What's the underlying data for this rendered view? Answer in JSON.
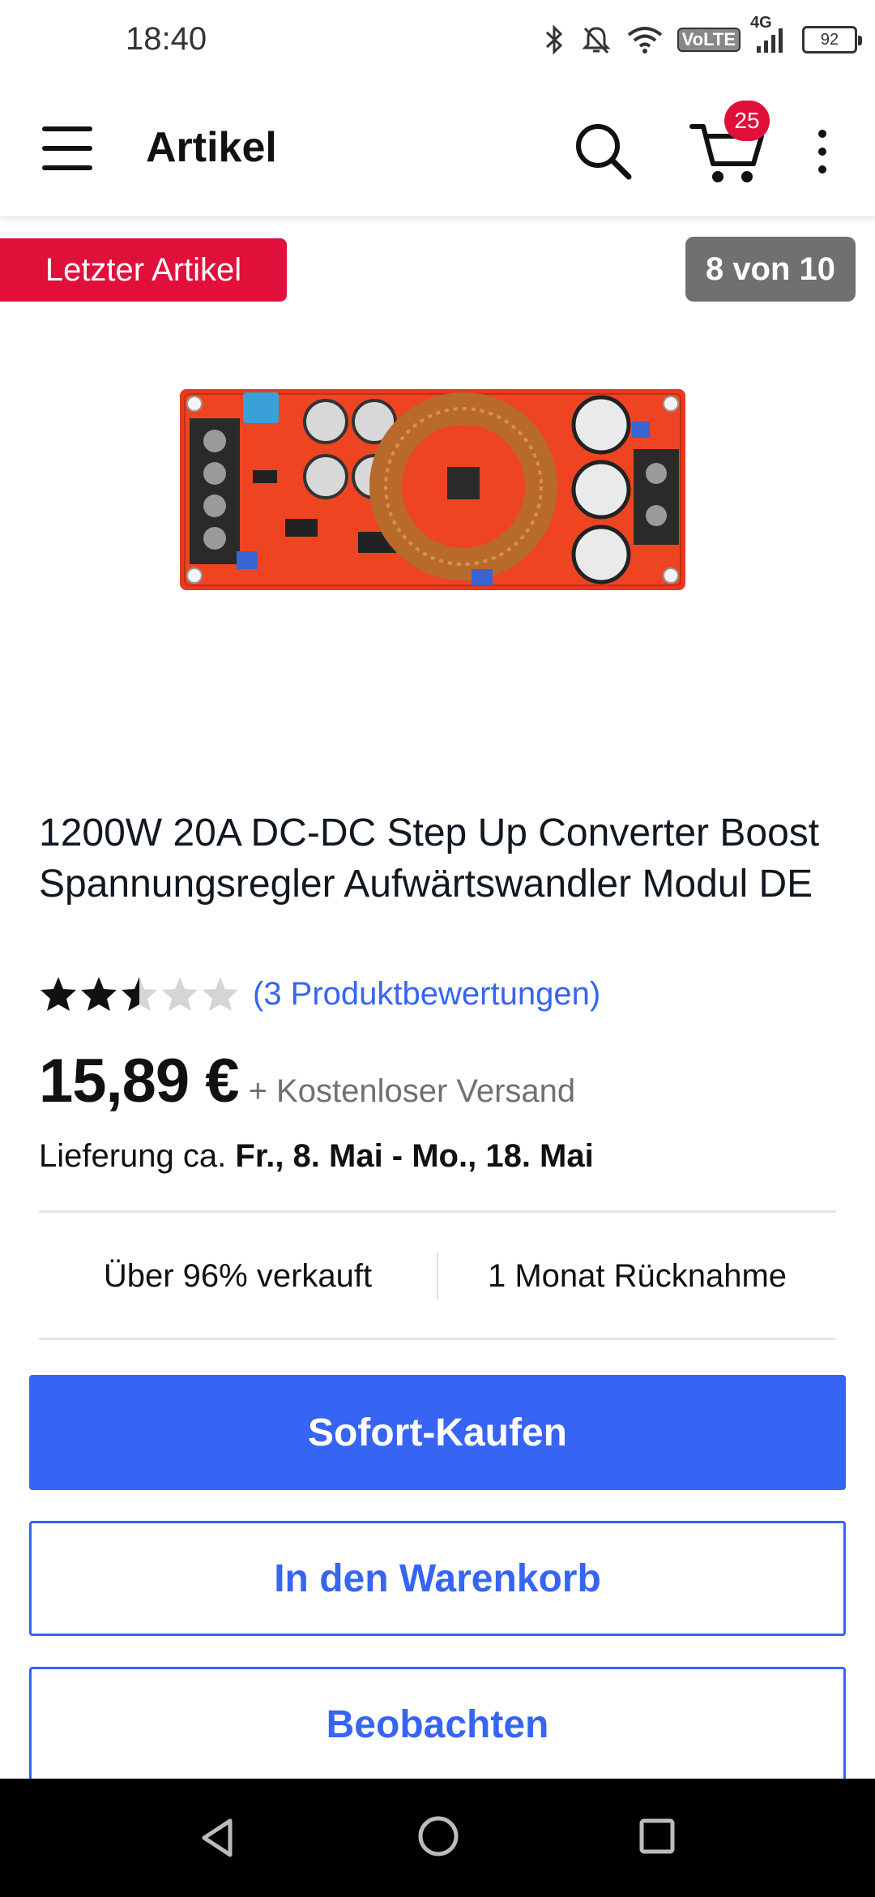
{
  "status_bar": {
    "time": "18:40",
    "network_label": "VoLTE",
    "network_type": "4G",
    "battery": "92",
    "icons": [
      "bluetooth-icon",
      "mute-icon",
      "wifi-icon",
      "signal-icon",
      "battery-icon"
    ]
  },
  "app_bar": {
    "title": "Artikel",
    "cart_count": "25",
    "icons": [
      "menu-icon",
      "search-icon",
      "cart-icon",
      "more-icon"
    ]
  },
  "tags": {
    "last_item": "Letzter Artikel",
    "counter": "8 von 10"
  },
  "product": {
    "title": "1200W 20A DC-DC Step Up Converter Boost Spannungsregler Aufwärtswandler Modul DE",
    "rating": 2.5,
    "rating_max": 5,
    "reviews_link": "(3 Produktbewertungen)",
    "price": "15,89 €",
    "shipping": "+ Kostenloser Versand",
    "delivery_prefix": "Lieferung ca.",
    "delivery_dates": "Fr., 8. Mai - Mo., 18. Mai",
    "sold_info": "Über 96% verkauft",
    "return_info": "1 Monat Rücknahme"
  },
  "buttons": {
    "buy_now": "Sofort-Kaufen",
    "add_to_cart": "In den Warenkorb",
    "watch": "Beobachten"
  },
  "colors": {
    "accent": "#3665f3",
    "badge_red": "#e0103a",
    "counter_gray": "#707070"
  },
  "nav_bar": {
    "icons": [
      "back-icon",
      "home-icon",
      "recents-icon"
    ]
  }
}
